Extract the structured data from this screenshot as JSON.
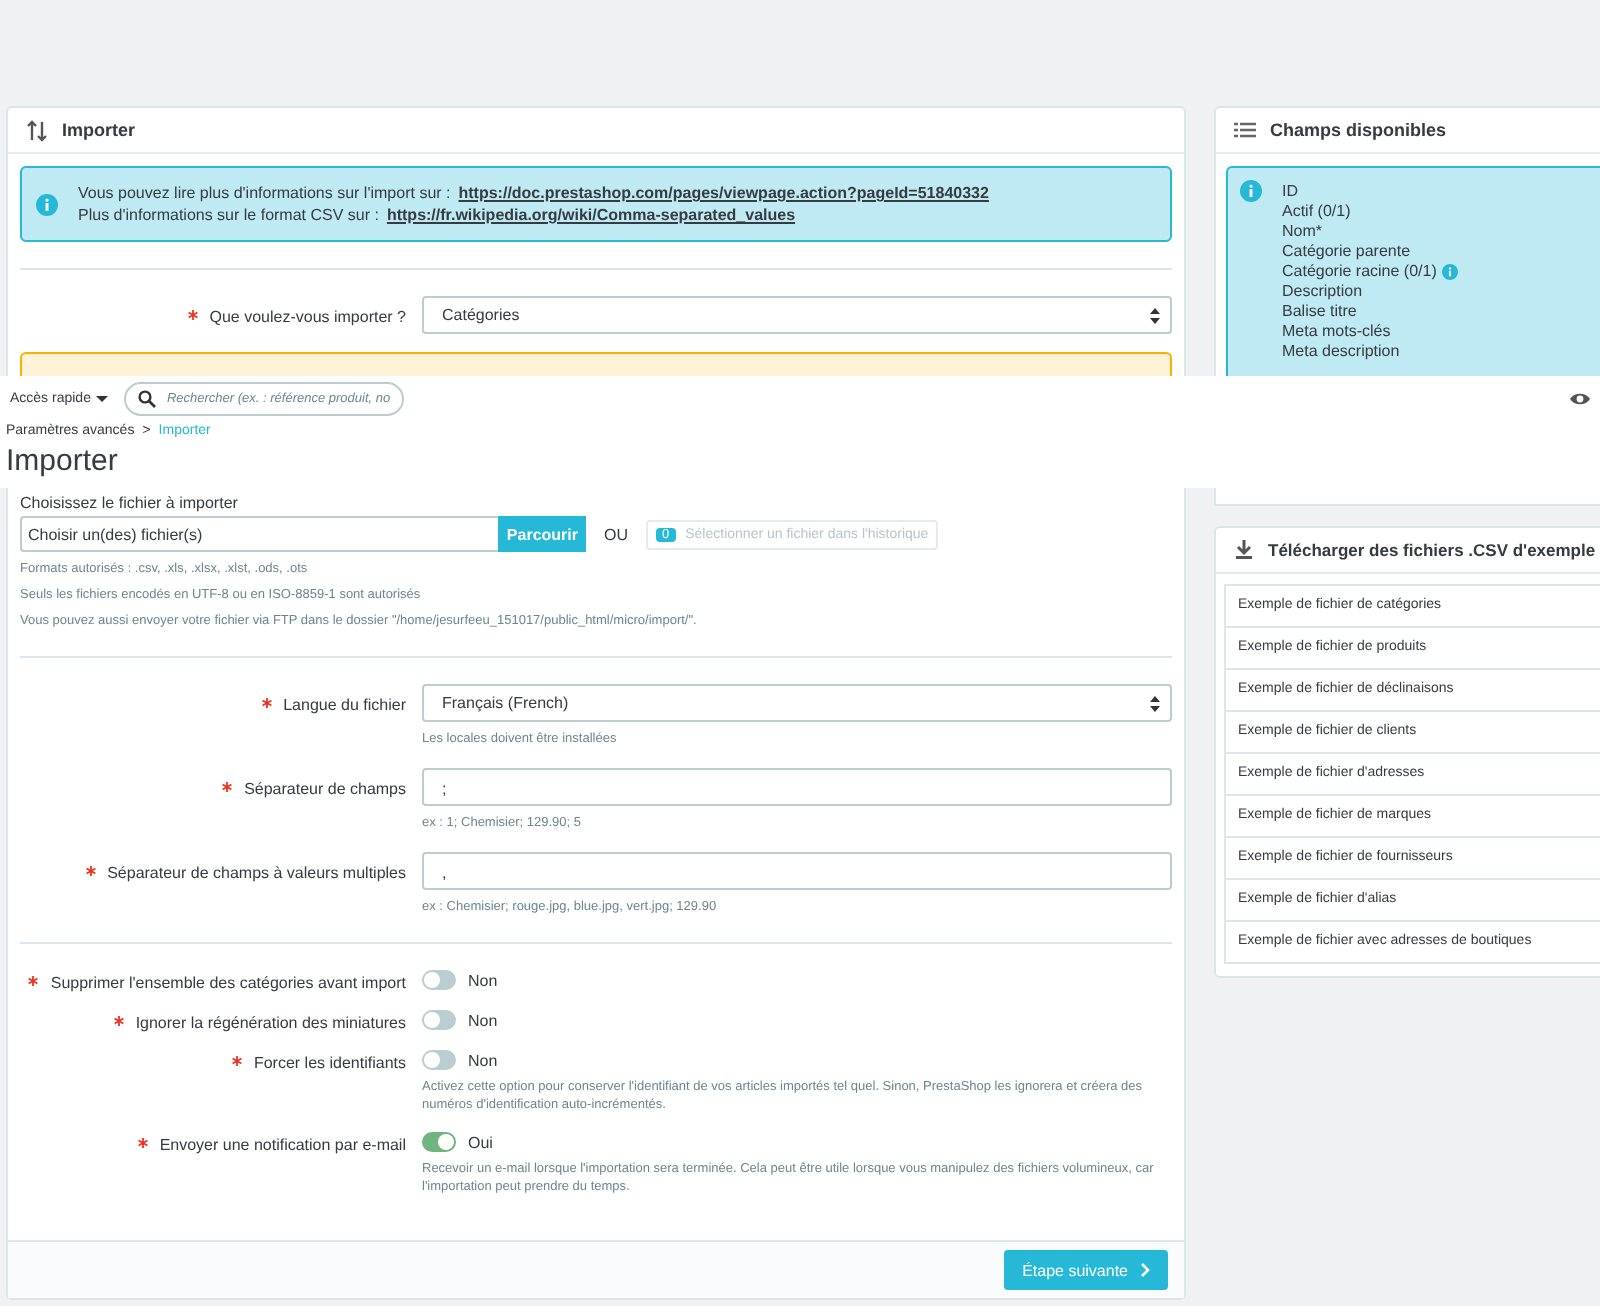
{
  "import_panel": {
    "title": "Importer",
    "info": [
      {
        "text": "Vous pouvez lire plus d'informations sur l'import sur :",
        "link": "https://doc.prestashop.com/pages/viewpage.action?pageId=51840332"
      },
      {
        "text": "Plus d'informations sur le format CSV sur :",
        "link": "https://fr.wikipedia.org/wiki/Comma-separated_values"
      }
    ],
    "entity": {
      "label": "Que voulez-vous importer ?",
      "required": true,
      "value": "Catégories"
    },
    "file": {
      "label": "Choisissez le fichier à importer",
      "value": "Choisir un(des) fichier(s)",
      "browse_button": "Parcourir",
      "or": "OU",
      "history_count": "0",
      "history_button": "Sélectionner un fichier dans l'historique",
      "history_disabled": true,
      "help": [
        "Formats autorisés : .csv, .xls, .xlsx, .xlst, .ods, .ots",
        "Seuls les fichiers encodés en UTF-8 ou en ISO-8859-1 sont autorisés",
        "Vous pouvez aussi envoyer votre fichier via FTP dans le dossier \"/home/jesurfeeu_151017/public_html/micro/import/\"."
      ]
    },
    "fields": [
      {
        "kind": "select",
        "label": "Langue du fichier",
        "required": true,
        "value": "Français (French)",
        "help": "Les locales doivent être installées"
      },
      {
        "kind": "text",
        "label": "Séparateur de champs",
        "required": true,
        "value": ";",
        "help": "ex : 1; Chemisier; 129.90; 5"
      },
      {
        "kind": "text",
        "label": "Séparateur de champs à valeurs multiples",
        "required": true,
        "value": ",",
        "help": "ex : Chemisier; rouge.jpg, blue.jpg, vert.jpg; 129.90"
      }
    ],
    "toggles": [
      {
        "label": "Supprimer l'ensemble des catégories avant import",
        "required": true,
        "on": false,
        "state": "Non"
      },
      {
        "label": "Ignorer la régénération des miniatures",
        "required": true,
        "on": false,
        "state": "Non"
      },
      {
        "label": "Forcer les identifiants",
        "required": true,
        "on": false,
        "state": "Non",
        "help": "Activez cette option pour conserver l'identifiant de vos articles importés tel quel. Sinon, PrestaShop les ignorera et créera des numéros d'identification auto-incrémentés."
      },
      {
        "label": "Envoyer une notification par e-mail",
        "required": true,
        "on": true,
        "state": "Oui",
        "help": "Recevoir un e-mail lorsque l'importation sera terminée. Cela peut être utile lorsque vous manipulez des fichiers volumineux, car l'importation peut prendre du temps."
      }
    ],
    "next_button": "Étape suivante"
  },
  "available_fields": {
    "title": "Champs disponibles",
    "items": [
      {
        "label": "ID",
        "info": false
      },
      {
        "label": "Actif (0/1)",
        "info": false
      },
      {
        "label": "Nom*",
        "info": false
      },
      {
        "label": "Catégorie parente",
        "info": false
      },
      {
        "label": "Catégorie racine (0/1)",
        "info": true
      },
      {
        "label": "Description",
        "info": false
      },
      {
        "label": "Balise titre",
        "info": false
      },
      {
        "label": "Meta mots-clés",
        "info": false
      },
      {
        "label": "Meta description",
        "info": false
      }
    ]
  },
  "samples": {
    "title": "Télécharger des fichiers .CSV d'exemple",
    "items": [
      "Exemple de fichier de catégories",
      "Exemple de fichier de produits",
      "Exemple de fichier de déclinaisons",
      "Exemple de fichier de clients",
      "Exemple de fichier d'adresses",
      "Exemple de fichier de marques",
      "Exemple de fichier de fournisseurs",
      "Exemple de fichier d'alias",
      "Exemple de fichier avec adresses de boutiques"
    ]
  },
  "page_header": {
    "quick_access": "Accès rapide",
    "search": {
      "placeholder": "Rechercher (ex. : référence produit, no"
    },
    "breadcrumb_separator": ">",
    "breadcrumb": [
      {
        "label": "Paramètres avancés",
        "selected": false
      },
      {
        "label": "Importer",
        "selected": true
      }
    ],
    "title": "Importer"
  }
}
